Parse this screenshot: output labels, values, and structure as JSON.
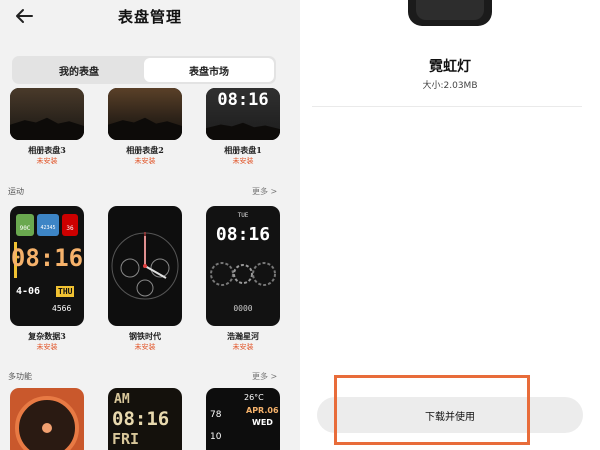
{
  "header": {
    "title": "表盘管理",
    "back_icon": "arrow-left-icon"
  },
  "tabs": [
    {
      "label": "我的表盘",
      "active": false
    },
    {
      "label": "表盘市场",
      "active": true
    }
  ],
  "row1": [
    {
      "name": "相册表盘3",
      "status": "未安装",
      "time": ""
    },
    {
      "name": "相册表盘2",
      "status": "未安装",
      "time": ""
    },
    {
      "name": "相册表盘1",
      "status": "未安装",
      "time": "08:16"
    }
  ],
  "section_sport": {
    "title": "运动",
    "more": "更多 >"
  },
  "row2": [
    {
      "name": "复杂数据3",
      "status": "未安装",
      "stats": [
        "90C",
        "42345",
        "36"
      ],
      "time": "08:16",
      "date": "4-06",
      "weekday": "THU",
      "steps": "4566"
    },
    {
      "name": "钢铁时代",
      "status": "未安装"
    },
    {
      "name": "浩瀚星河",
      "status": "未安装",
      "weekday": "TUE",
      "time": "08:16",
      "bottom": "0000"
    }
  ],
  "section_multi": {
    "title": "多功能",
    "more": "更多 >"
  },
  "row3": [
    {
      "time": ""
    },
    {
      "lines": [
        "AM",
        "08:16",
        "FRI"
      ]
    },
    {
      "temp": "26°C",
      "date": "APR.06",
      "weekday": "WED",
      "values": [
        "78",
        "10"
      ]
    }
  ],
  "detail": {
    "face_name": "霓虹灯",
    "size": "大小:2.03MB",
    "download_button": "下载并使用"
  },
  "colors": {
    "accent": "#e2572b",
    "highlight": "#e86c3a",
    "button_bg": "#ececec"
  }
}
